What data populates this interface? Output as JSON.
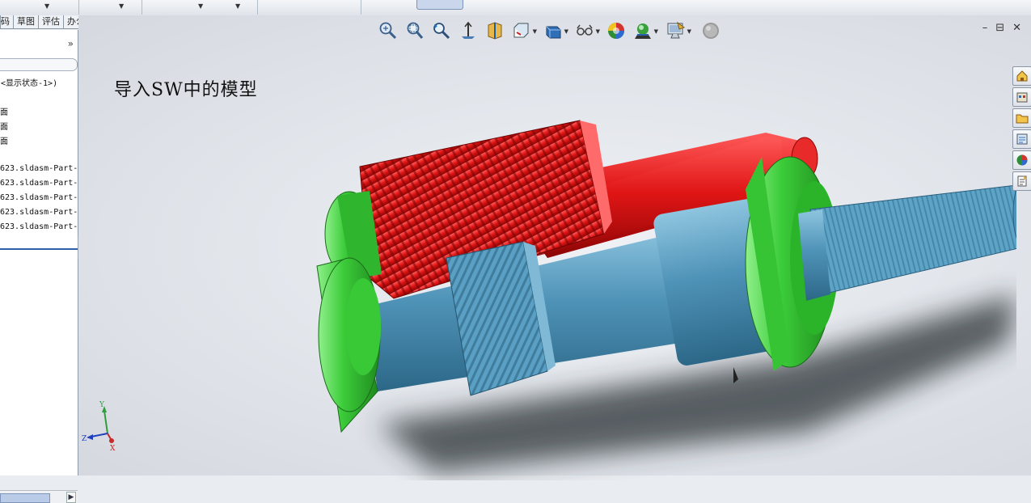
{
  "tabs": [
    "码",
    "草图",
    "评估",
    "办公室产品"
  ],
  "panel": {
    "collapse_label": "»",
    "tree_items": [
      "<显示状态-1>)",
      "面",
      "面",
      "面",
      "623.sldasm-Part-",
      "623.sldasm-Part-",
      "623.sldasm-Part-",
      "623.sldasm-Part-",
      "623.sldasm-Part-"
    ]
  },
  "viewport": {
    "title": "导入SW中的模型",
    "window_controls": {
      "minimize": "–",
      "restore": "⊟",
      "close": "✕"
    },
    "axes": {
      "x": "X",
      "y": "Y",
      "z": "Z"
    }
  },
  "colors": {
    "gear_red": "#d10f10",
    "shaft_blue": "#4f93b8",
    "bearing_green": "#38c236",
    "background": "#e2e5ea"
  },
  "icons": {
    "heads_up": [
      "zoom-to-fit-icon",
      "zoom-to-area-icon",
      "previous-view-icon",
      "section-view-icon",
      "view-orientation-icon",
      "display-style-icon",
      "hide-show-icon",
      "edit-appearance-icon",
      "apply-scene-icon",
      "view-settings-icon",
      "realview-icon"
    ],
    "task_pane": [
      "home-icon",
      "design-library-icon",
      "file-explorer-icon",
      "view-palette-icon",
      "appearances-icon",
      "custom-properties-icon"
    ]
  }
}
